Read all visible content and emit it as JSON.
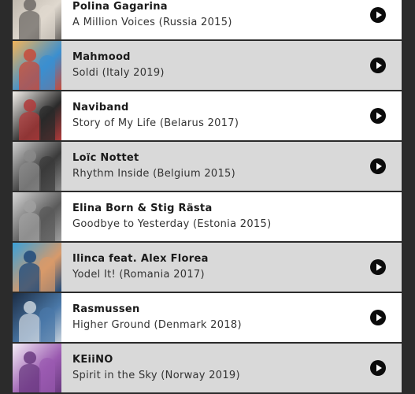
{
  "tracks": [
    {
      "artist": "Polina Gagarina",
      "song": "A Million Voices (Russia 2015)",
      "bg": "white",
      "has_play": true,
      "cover_colors": [
        "#b9b2a8",
        "#e0d9cf",
        "#6e6a66"
      ],
      "cover_icon": "album-cover-polina-gagarina"
    },
    {
      "artist": "Mahmood",
      "song": "Soldi (Italy 2019)",
      "bg": "grey",
      "has_play": true,
      "cover_colors": [
        "#f2b45a",
        "#3a8fd0",
        "#c84a3a"
      ],
      "cover_icon": "album-cover-mahmood"
    },
    {
      "artist": "Naviband",
      "song": "Story of My Life (Belarus 2017)",
      "bg": "white",
      "has_play": true,
      "cover_colors": [
        "#f4f0ec",
        "#2a2a2a",
        "#b23a3a"
      ],
      "cover_icon": "album-cover-naviband"
    },
    {
      "artist": "Loïc Nottet",
      "song": "Rhythm Inside (Belgium 2015)",
      "bg": "grey",
      "has_play": true,
      "cover_colors": [
        "#cfcfcf",
        "#3a3a3a",
        "#8a8a8a"
      ],
      "cover_icon": "album-cover-loic-nottet"
    },
    {
      "artist": "Elina Born & Stig Rästa",
      "song": "Goodbye to Yesterday (Estonia 2015)",
      "bg": "white",
      "has_play": false,
      "cover_colors": [
        "#d6d6d6",
        "#5a5a5a",
        "#a0a0a0"
      ],
      "cover_icon": "album-cover-elina-born-stig-rasta"
    },
    {
      "artist": "Ilinca feat. Alex Florea",
      "song": "Yodel It! (Romania 2017)",
      "bg": "grey",
      "has_play": true,
      "cover_colors": [
        "#3aa0d8",
        "#d89a6a",
        "#1f4a7a"
      ],
      "cover_icon": "album-cover-ilinca"
    },
    {
      "artist": "Rasmussen",
      "song": "Higher Ground (Denmark 2018)",
      "bg": "white",
      "has_play": true,
      "cover_colors": [
        "#1c2d44",
        "#4a78a8",
        "#c8d2dc"
      ],
      "cover_icon": "album-cover-rasmussen"
    },
    {
      "artist": "KEiiNO",
      "song": "Spirit in the Sky (Norway 2019)",
      "bg": "grey",
      "has_play": true,
      "cover_colors": [
        "#f4eef6",
        "#9a5ab0",
        "#6a3a80"
      ],
      "cover_icon": "album-cover-keiino"
    }
  ],
  "colors": {
    "page_bg": "#2b2b2b",
    "row_white": "#ffffff",
    "row_grey": "#d9d9d9",
    "play_button": "#0b0b0b"
  },
  "play_icon": "play-circle-icon"
}
